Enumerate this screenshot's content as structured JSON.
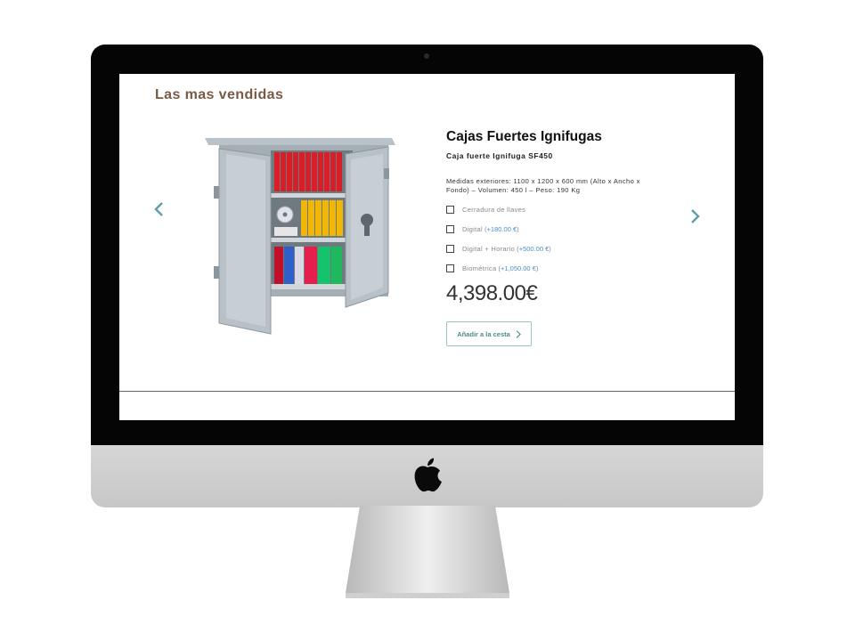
{
  "section": {
    "title": "Las mas vendidas"
  },
  "product": {
    "title": "Cajas Fuertes Ignifugas",
    "subtitle": "Caja fuerte Ignifuga SF450",
    "description": "Medidas exteriores: 1100 x 1200 x 600 mm (Alto x Ancho x Fondo) – Volumen: 450 l – Peso: 190 Kg",
    "options": [
      {
        "label": "Cerradura de llaves",
        "price": ""
      },
      {
        "label": "Digital",
        "price": "+180.00 €"
      },
      {
        "label": "Digital + Horario",
        "price": "+500.00 €"
      },
      {
        "label": "Biométrica",
        "price": "+1,050.00 €"
      }
    ],
    "price": "4,398.00€",
    "cart_button": "Añadir a la cesta"
  },
  "icons": {
    "prev": "chevron-left-icon",
    "next": "chevron-right-icon",
    "logo": "apple-logo-icon"
  },
  "colors": {
    "title_brown": "#7a5a45",
    "accent_teal": "#5f9ea5",
    "price_blue": "#4a8ec5"
  }
}
